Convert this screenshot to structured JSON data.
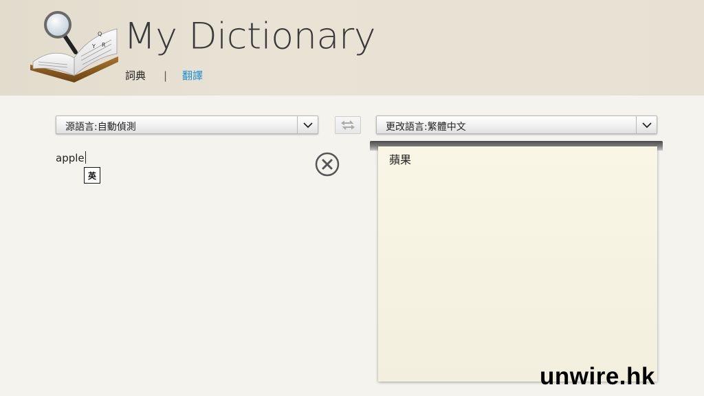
{
  "app": {
    "title": "My Dictionary",
    "logo_icon": "book-magnifier-icon"
  },
  "nav": {
    "dictionary": "詞典",
    "separator": "|",
    "translate": "翻譯",
    "active_color": "#1a8fd0"
  },
  "translator": {
    "source_language_label": "源語言:自動偵測",
    "target_language_label": "更改語言:繁體中文",
    "swap_icon": "swap-arrows-icon",
    "dropdown_icon": "chevron-down-icon",
    "input_text": "apple",
    "ime_indicator": "英",
    "clear_icon": "close-circle-icon",
    "result_text": "蘋果"
  },
  "watermark": "unwire.hk"
}
